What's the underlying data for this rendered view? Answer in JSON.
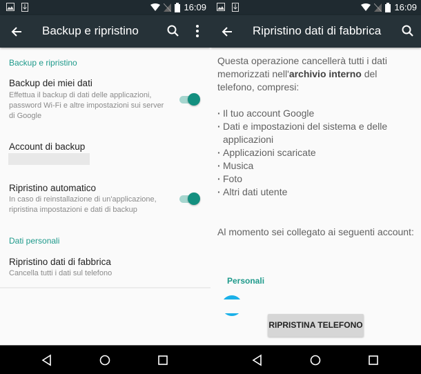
{
  "status_bar": {
    "time": "16:09",
    "left_icons": [
      "image-notification-icon",
      "download-notification-icon"
    ],
    "right_icons": [
      "wifi-icon",
      "no-sim-icon",
      "battery-icon"
    ]
  },
  "left_screen": {
    "toolbar": {
      "title": "Backup e ripristino",
      "icons": [
        "back-arrow-icon",
        "search-icon",
        "more-vert-icon"
      ]
    },
    "sections": [
      {
        "category": "Backup e ripristino",
        "items": [
          {
            "title": "Backup dei miei dati",
            "summary": "Effettua il backup di dati delle applicazioni, password Wi-Fi e altre impostazioni sui server di Google",
            "switch_on": true
          },
          {
            "title": "Account di backup",
            "summary": ""
          },
          {
            "title": "Ripristino automatico",
            "summary": "In caso di reinstallazione di un'applicazione, ripristina impostazioni e dati di backup",
            "switch_on": true
          }
        ]
      },
      {
        "category": "Dati personali",
        "items": [
          {
            "title": "Ripristino dati di fabbrica",
            "summary": "Cancella tutti i dati sul telefono"
          }
        ]
      }
    ]
  },
  "right_screen": {
    "toolbar": {
      "title": "Ripristino dati di fabbrica",
      "icons": [
        "back-arrow-icon",
        "search-icon"
      ]
    },
    "intro_before": "Questa operazione cancellerà tutti i dati memorizzati nell'",
    "intro_bold": "archivio interno",
    "intro_after": " del telefono, compresi:",
    "list": [
      "Il tuo account Google",
      "Dati e impostazioni del sistema e delle applicazioni",
      "Applicazioni scaricate",
      "Musica",
      "Foto",
      "Altri dati utente"
    ],
    "accounts_text": "Al momento sei collegato ai seguenti account:",
    "accounts_category": "Personali",
    "reset_button": "RIPRISTINA TELEFONO"
  },
  "nav_bar": {
    "buttons": [
      "back-triangle-icon",
      "home-circle-icon",
      "recents-square-icon"
    ]
  },
  "colors": {
    "toolbar": "#263238",
    "status_bar": "#1f2a30",
    "accent": "#138f7f",
    "category_text": "#1e9a8b"
  }
}
